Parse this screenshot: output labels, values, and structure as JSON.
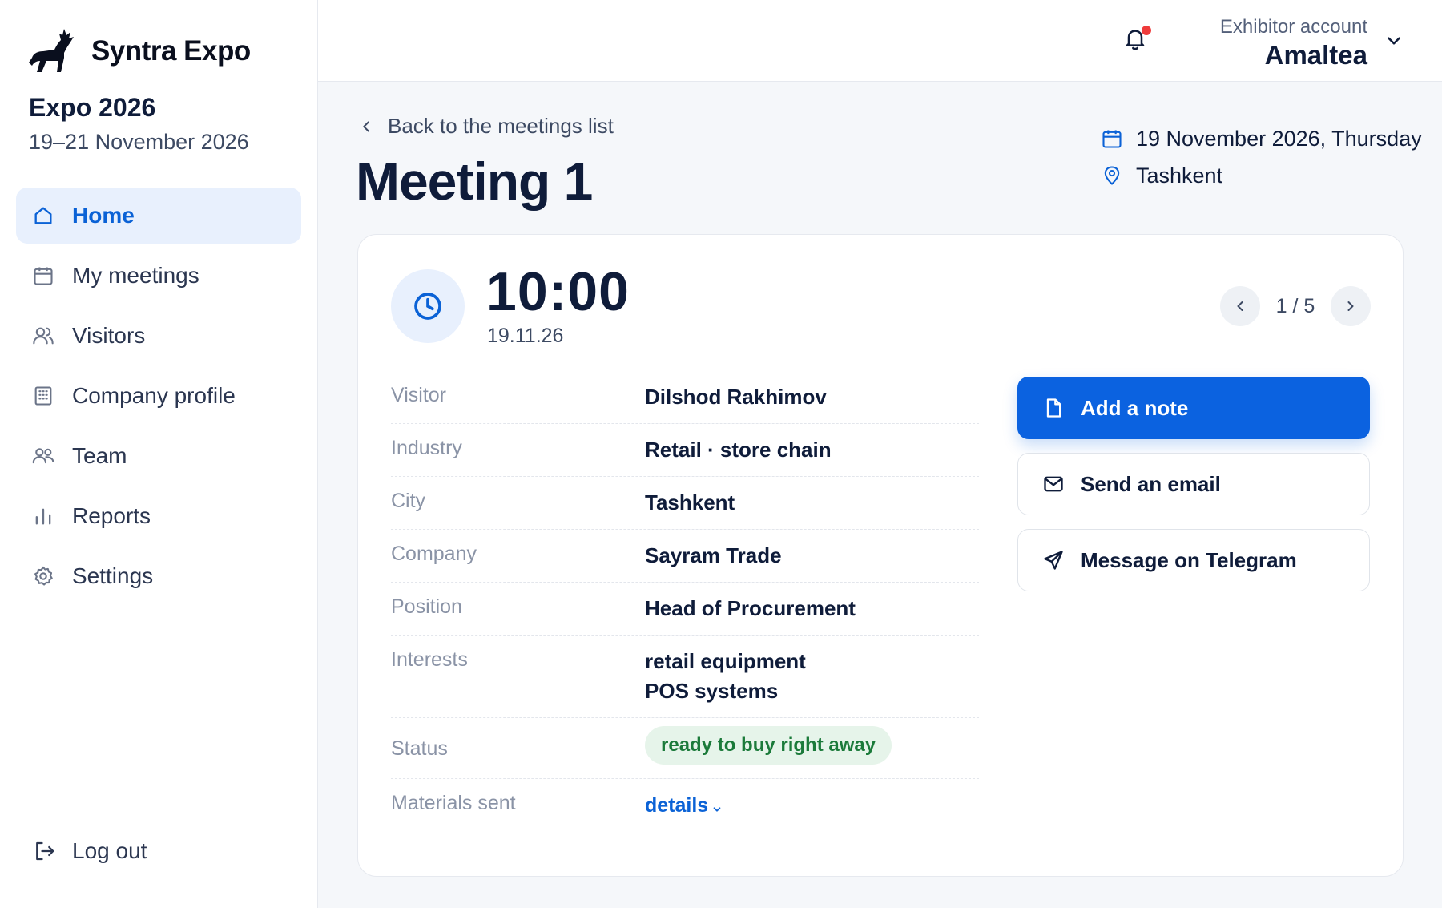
{
  "brand": {
    "name": "Syntra Expo",
    "logo_icon": "deer-logo-icon"
  },
  "event": {
    "title": "Expo 2026",
    "dates": "19–21 November 2026"
  },
  "sidebar": {
    "items": [
      {
        "label": "Home",
        "icon": "home-icon",
        "active": true
      },
      {
        "label": "My meetings",
        "icon": "calendar-icon"
      },
      {
        "label": "Visitors",
        "icon": "users-icon"
      },
      {
        "label": "Company profile",
        "icon": "building-icon"
      },
      {
        "label": "Team",
        "icon": "team-icon"
      },
      {
        "label": "Reports",
        "icon": "bar-chart-icon"
      },
      {
        "label": "Settings",
        "icon": "gear-icon"
      }
    ],
    "logout_label": "Log out"
  },
  "topbar": {
    "account_role": "Exhibitor account",
    "account_name": "Amaltea",
    "notification_dot_color": "#ef3b3b"
  },
  "header": {
    "back_label": "Back to the meetings list",
    "title": "Meeting 1",
    "date": "19 November 2026, Thursday",
    "location": "Tashkent"
  },
  "meeting": {
    "time": "10:00",
    "date_short": "19.11.26",
    "pager": "1 / 5",
    "fields": {
      "visitor": {
        "label": "Visitor",
        "value": "Dilshod Rakhimov"
      },
      "industry": {
        "label": "Industry",
        "value": "Retail · store chain"
      },
      "city": {
        "label": "City",
        "value": "Tashkent"
      },
      "company": {
        "label": "Company",
        "value": "Sayram Trade"
      },
      "position": {
        "label": "Position",
        "value": "Head of Procurement"
      },
      "interests": {
        "label": "Interests",
        "values": [
          "retail equipment",
          "POS systems"
        ]
      },
      "status": {
        "label": "Status",
        "value": "ready to buy right away"
      },
      "materials": {
        "label": "Materials sent",
        "link": "details"
      }
    }
  },
  "actions": {
    "add_note": "Add a note",
    "send_email": "Send an email",
    "telegram": "Message on Telegram"
  },
  "colors": {
    "accent": "#0b62d6",
    "primary_button": "#0b62e0",
    "status_badge_bg": "#e6f4ea",
    "status_badge_text": "#1b7a3a"
  }
}
